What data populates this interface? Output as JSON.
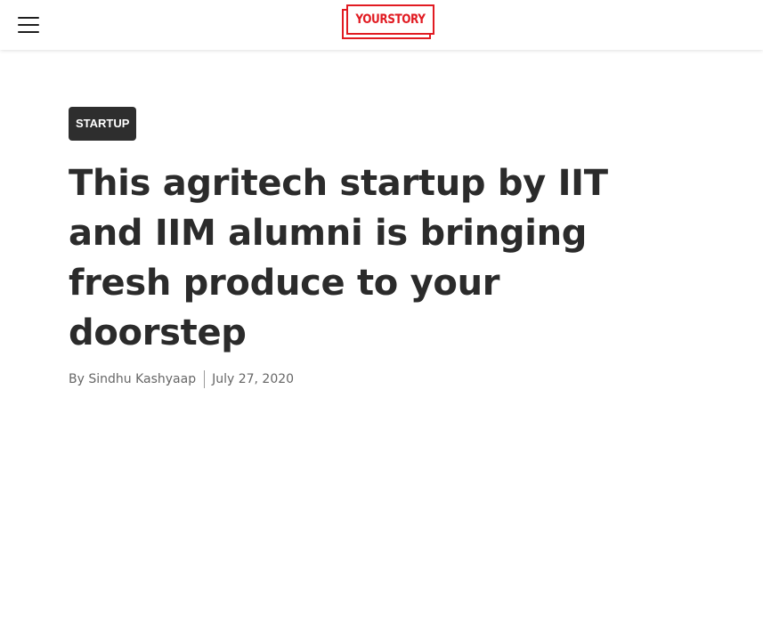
{
  "header": {
    "logo_text": "YOURSTORY",
    "brand_color": "#e11b22",
    "menu_icon": "hamburger-menu-icon"
  },
  "article": {
    "category": "STARTUP",
    "title": "This agritech startup by IIT and IIM alumni is bringing fresh produce to your doorstep",
    "author": "By Sindhu Kashyaap",
    "date": "July 27, 2020"
  }
}
